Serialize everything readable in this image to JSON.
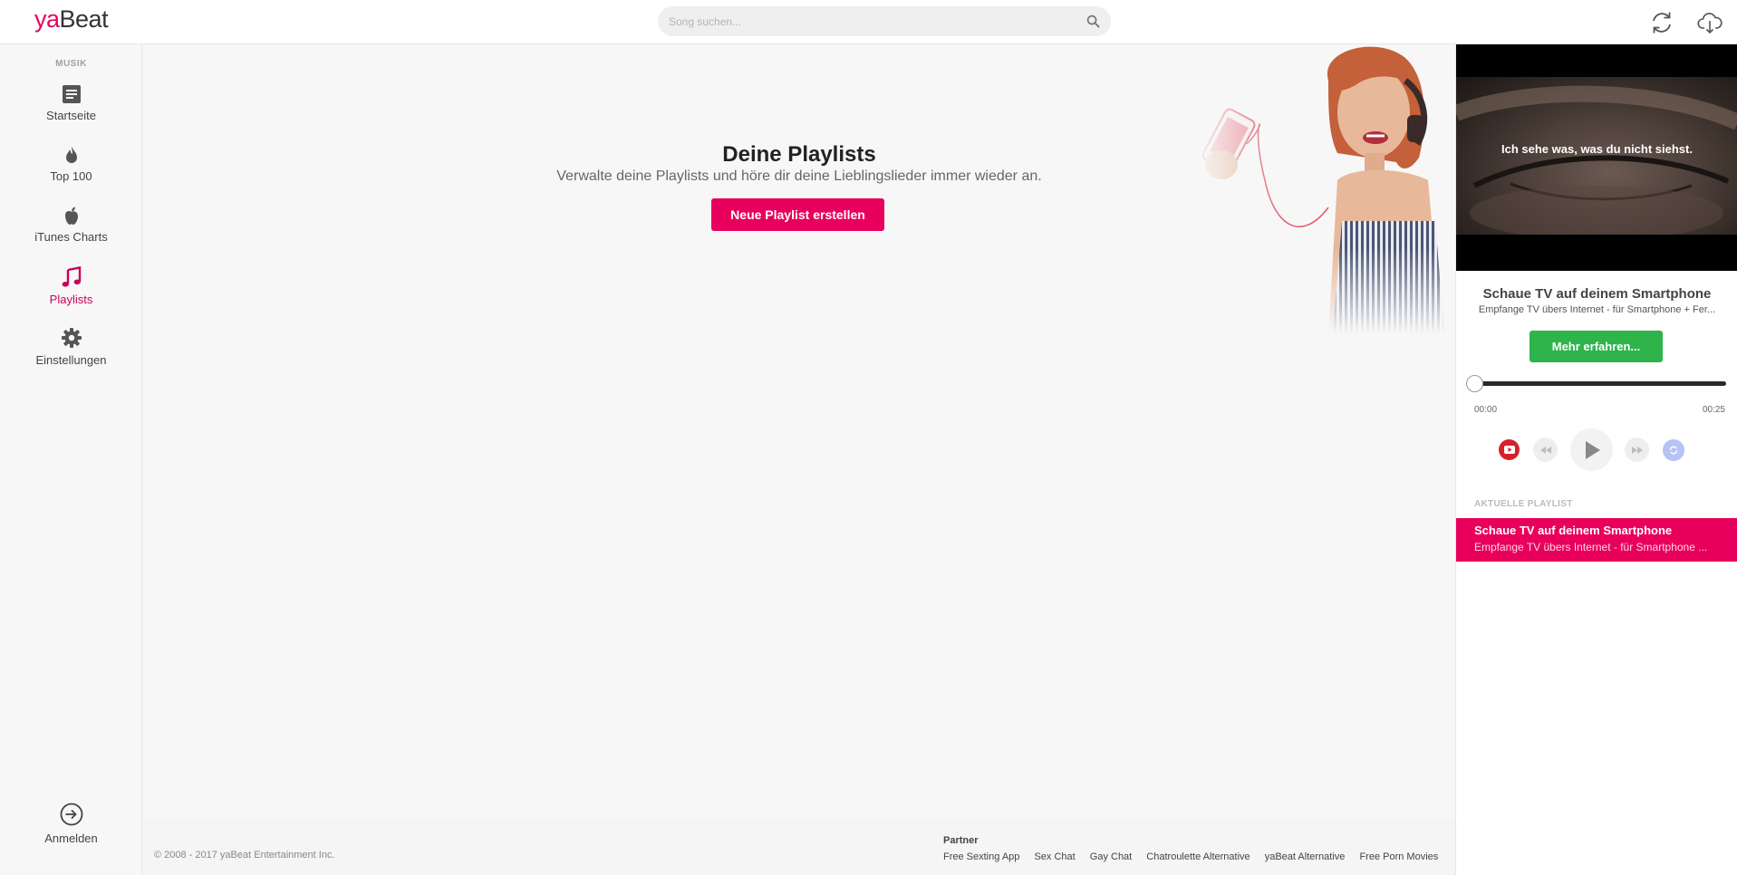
{
  "header": {
    "logo_ya": "ya",
    "logo_beat": "Beat",
    "search_placeholder": "Song suchen...",
    "accent_color": "#e8005c"
  },
  "sidebar": {
    "section_label": "MUSIK",
    "items": [
      {
        "label": "Startseite",
        "icon": "document-icon",
        "active": false
      },
      {
        "label": "Top 100",
        "icon": "flame-icon",
        "active": false
      },
      {
        "label": "iTunes Charts",
        "icon": "apple-icon",
        "active": false
      },
      {
        "label": "Playlists",
        "icon": "music-note-icon",
        "active": true
      },
      {
        "label": "Einstellungen",
        "icon": "gear-icon",
        "active": false
      }
    ],
    "login_label": "Anmelden"
  },
  "main": {
    "title": "Deine Playlists",
    "subtitle": "Verwalte deine Playlists und höre dir deine Lieblingslieder immer wieder an.",
    "new_playlist_button": "Neue Playlist erstellen"
  },
  "footer": {
    "copyright": "© 2008 - 2017 yaBeat Entertainment Inc.",
    "partner_title": "Partner",
    "partner_links": [
      "Free Sexting App",
      "Sex Chat",
      "Gay Chat",
      "Chatroulette Alternative",
      "yaBeat Alternative",
      "Free Porn Movies"
    ]
  },
  "player": {
    "video_caption": "Ich sehe was, was du nicht siehst.",
    "now_playing_title": "Schaue TV auf deinem Smartphone",
    "now_playing_subtitle": "Empfange TV übers Internet - für Smartphone + Fer...",
    "more_button": "Mehr erfahren...",
    "time_current": "00:00",
    "time_total": "00:25",
    "progress": 0.0
  },
  "playlist": {
    "heading": "AKTUELLE PLAYLIST",
    "items": [
      {
        "title": "Schaue TV auf deinem Smartphone",
        "subtitle": "Empfange TV übers Internet - für Smartphone ..."
      }
    ]
  }
}
